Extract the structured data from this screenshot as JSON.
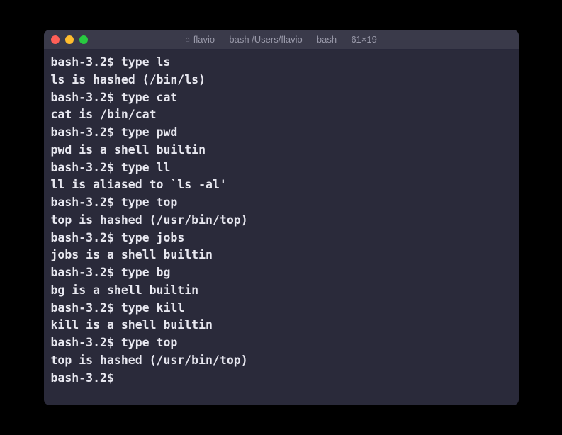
{
  "window": {
    "title": "flavio — bash /Users/flavio — bash — 61×19"
  },
  "terminal": {
    "prompt": "bash-3.2$ ",
    "lines": [
      {
        "type": "cmd",
        "text": "type ls"
      },
      {
        "type": "out",
        "text": "ls is hashed (/bin/ls)"
      },
      {
        "type": "cmd",
        "text": "type cat"
      },
      {
        "type": "out",
        "text": "cat is /bin/cat"
      },
      {
        "type": "cmd",
        "text": "type pwd"
      },
      {
        "type": "out",
        "text": "pwd is a shell builtin"
      },
      {
        "type": "cmd",
        "text": "type ll"
      },
      {
        "type": "out",
        "text": "ll is aliased to `ls -al'"
      },
      {
        "type": "cmd",
        "text": "type top"
      },
      {
        "type": "out",
        "text": "top is hashed (/usr/bin/top)"
      },
      {
        "type": "cmd",
        "text": "type jobs"
      },
      {
        "type": "out",
        "text": "jobs is a shell builtin"
      },
      {
        "type": "cmd",
        "text": "type bg"
      },
      {
        "type": "out",
        "text": "bg is a shell builtin"
      },
      {
        "type": "cmd",
        "text": "type kill"
      },
      {
        "type": "out",
        "text": "kill is a shell builtin"
      },
      {
        "type": "cmd",
        "text": "type top"
      },
      {
        "type": "out",
        "text": "top is hashed (/usr/bin/top)"
      },
      {
        "type": "cmd",
        "text": ""
      }
    ]
  }
}
